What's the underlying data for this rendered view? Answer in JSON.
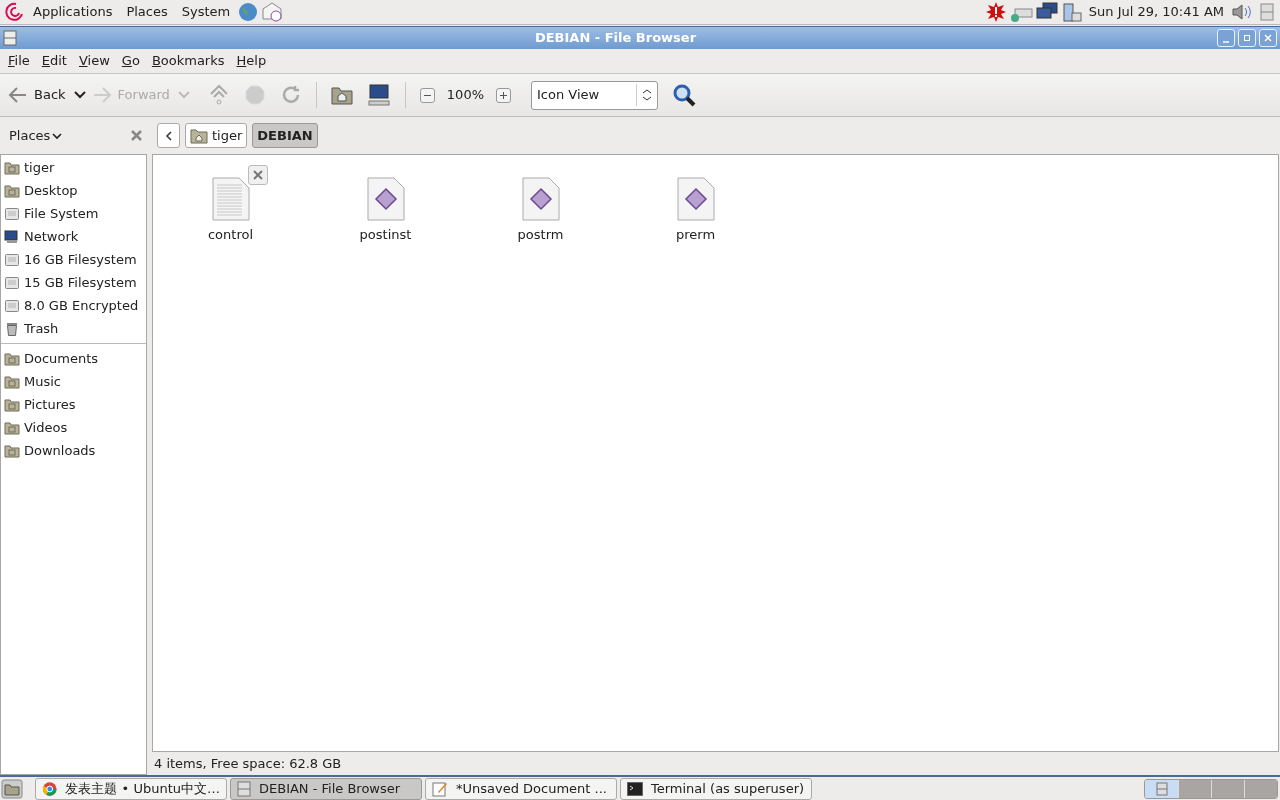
{
  "top_panel": {
    "menus": [
      "Applications",
      "Places",
      "System"
    ],
    "clock": "Sun Jul 29, 10:41 AM"
  },
  "window": {
    "title": "DEBIAN - File Browser"
  },
  "menubar": [
    "File",
    "Edit",
    "View",
    "Go",
    "Bookmarks",
    "Help"
  ],
  "toolbar": {
    "back": {
      "label": "Back",
      "disabled": false
    },
    "forward": {
      "label": "Forward",
      "disabled": true
    },
    "zoom": "100%",
    "view": "Icon View"
  },
  "sidebar": {
    "title": "Places",
    "groups": [
      [
        {
          "label": "tiger",
          "kind": "home"
        },
        {
          "label": "Desktop",
          "kind": "desktop"
        },
        {
          "label": "File System",
          "kind": "drive"
        },
        {
          "label": "Network",
          "kind": "network"
        },
        {
          "label": "16 GB Filesystem",
          "kind": "drive"
        },
        {
          "label": "15 GB Filesystem",
          "kind": "drive"
        },
        {
          "label": "8.0 GB Encrypted",
          "kind": "drive"
        },
        {
          "label": "Trash",
          "kind": "trash"
        }
      ],
      [
        {
          "label": "Documents",
          "kind": "folder"
        },
        {
          "label": "Music",
          "kind": "folder"
        },
        {
          "label": "Pictures",
          "kind": "folder"
        },
        {
          "label": "Videos",
          "kind": "folder"
        },
        {
          "label": "Downloads",
          "kind": "folder"
        }
      ]
    ]
  },
  "path_bar": [
    {
      "label": "tiger",
      "kind": "home",
      "selected": false
    },
    {
      "label": "DEBIAN",
      "kind": "plain",
      "selected": true
    }
  ],
  "files": [
    {
      "name": "control",
      "kind": "text"
    },
    {
      "name": "postinst",
      "kind": "script"
    },
    {
      "name": "postrm",
      "kind": "script"
    },
    {
      "name": "prerm",
      "kind": "script"
    }
  ],
  "status": "4 items, Free space: 62.8 GB",
  "taskbar": {
    "tasks": [
      {
        "label": "发表主题 • Ubuntu中文…",
        "kind": "browser",
        "selected": false
      },
      {
        "label": "DEBIAN - File Browser",
        "kind": "files",
        "selected": true
      },
      {
        "label": "*Unsaved Document ...",
        "kind": "editor",
        "selected": false
      },
      {
        "label": "Terminal (as superuser)",
        "kind": "terminal",
        "selected": false
      }
    ],
    "workspaces": [
      {
        "selected": true
      },
      {
        "selected": false
      },
      {
        "selected": false
      },
      {
        "selected": false
      }
    ]
  }
}
